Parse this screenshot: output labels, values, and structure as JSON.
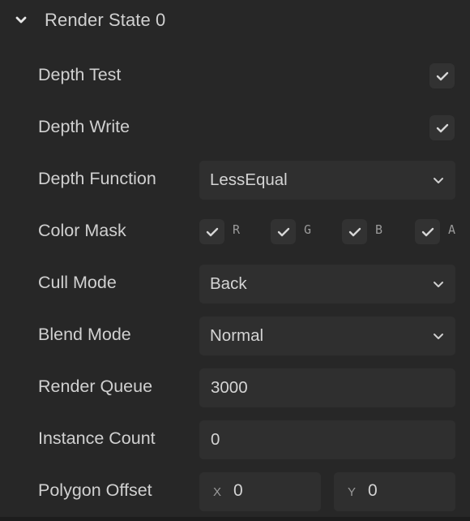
{
  "section": {
    "title": "Render State 0",
    "expanded": true,
    "icon": "chevron-down-icon"
  },
  "fields": {
    "depth_test": {
      "label": "Depth Test",
      "checked": true
    },
    "depth_write": {
      "label": "Depth Write",
      "checked": true
    },
    "depth_function": {
      "label": "Depth Function",
      "value": "LessEqual"
    },
    "color_mask": {
      "label": "Color Mask",
      "channels": [
        {
          "name": "R",
          "checked": true
        },
        {
          "name": "G",
          "checked": true
        },
        {
          "name": "B",
          "checked": true
        },
        {
          "name": "A",
          "checked": true
        }
      ]
    },
    "cull_mode": {
      "label": "Cull Mode",
      "value": "Back"
    },
    "blend_mode": {
      "label": "Blend Mode",
      "value": "Normal"
    },
    "render_queue": {
      "label": "Render Queue",
      "value": "3000"
    },
    "instance_count": {
      "label": "Instance Count",
      "value": "0"
    },
    "polygon_offset": {
      "label": "Polygon Offset",
      "x": {
        "axis": "X",
        "value": "0"
      },
      "y": {
        "axis": "Y",
        "value": "0"
      }
    }
  },
  "colors": {
    "background": "#272727",
    "control_bg": "#2f2f2f",
    "checkbox_bg": "#323232",
    "text": "#d0d0d0",
    "muted_text": "#9a9a9a"
  }
}
